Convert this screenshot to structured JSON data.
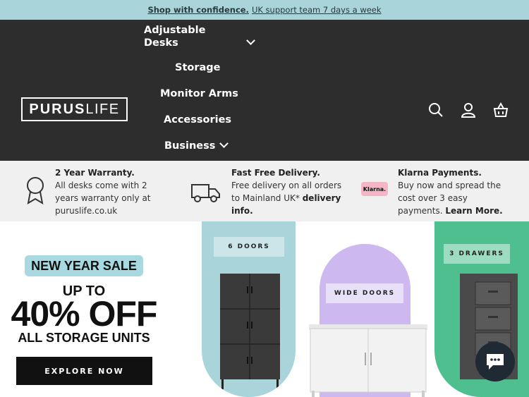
{
  "announcement": {
    "bold": "Shop with confidence.",
    "rest": "UK support team 7 days a week"
  },
  "logo": {
    "part1": "PURUS",
    "part2": "LIFE"
  },
  "nav": [
    {
      "label": "Adjustable Desks",
      "line1": "Adjustable",
      "line2": "Desks",
      "has_dropdown": true
    },
    {
      "label": "Storage"
    },
    {
      "label": "Monitor Arms"
    },
    {
      "label": "Accessories"
    },
    {
      "label": "Business",
      "has_dropdown": true
    }
  ],
  "header_icons": [
    "search-icon",
    "account-icon",
    "basket-icon"
  ],
  "usps": [
    {
      "title": "2 Year Warranty.",
      "body": [
        "All desks come with 2",
        "years warranty only at",
        "puruslife.co.uk"
      ],
      "icon": "award-ribbon-icon"
    },
    {
      "title": "Fast Free Delivery.",
      "body": [
        "Free delivery on all orders",
        "to Mainland UK*"
      ],
      "link": "delivery",
      "link2": "info.",
      "icon": "delivery-truck-icon"
    },
    {
      "title": "Klarna Payments.",
      "body": [
        "Buy now and spread the",
        "cost over 3 easy",
        "payments."
      ],
      "link": "Learn More.",
      "badge": "Klarna."
    }
  ],
  "hero": {
    "pill": "NEW YEAR SALE",
    "line1": "UP TO",
    "line2": "40% OFF",
    "line3": "ALL STORAGE UNITS",
    "cta": "EXPLORE NOW",
    "tags": [
      "6 DOORS",
      "WIDE DOORS",
      "3 DRAWERS"
    ],
    "colors": {
      "teal": "#a8d4da",
      "lavender": "#cdb8ef",
      "green": "#4fbf8f"
    }
  }
}
